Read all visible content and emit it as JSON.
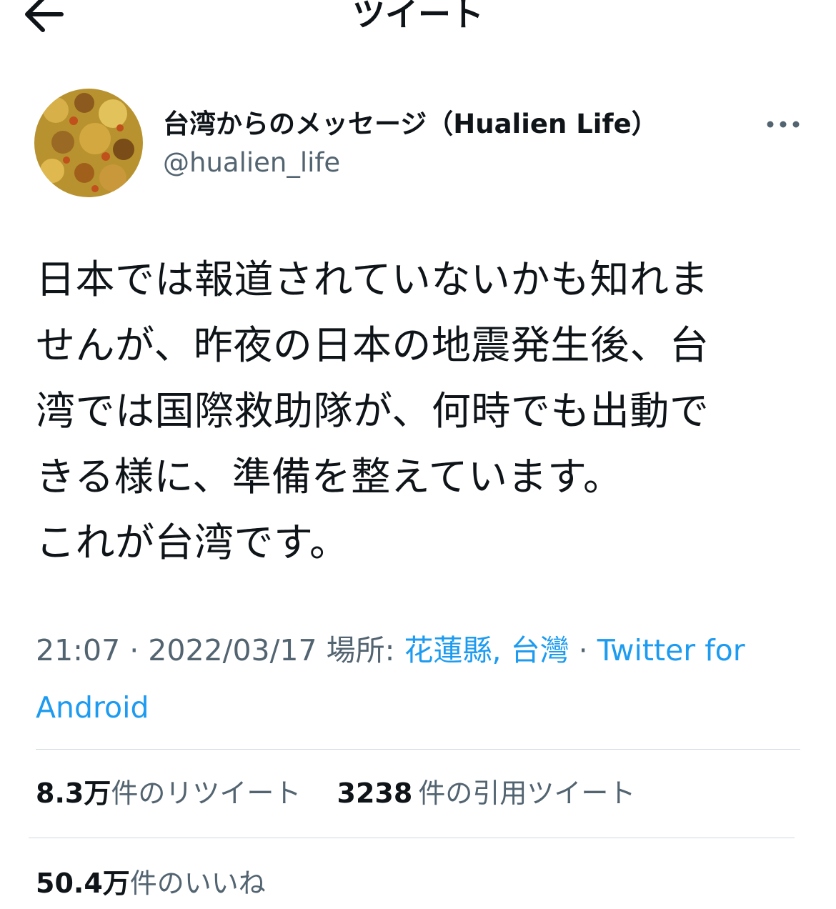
{
  "header": {
    "title": "ツイート",
    "back_icon": "arrow-left-icon",
    "more_icon": "more-horizontal-icon"
  },
  "author": {
    "display_name": "台湾からのメッセージ（Hualien Life）",
    "handle": "@hualien_life",
    "avatar_icon": "avatar-image"
  },
  "tweet": {
    "lines": [
      "日本では報道されていないかも知れま",
      "せんが、昨夜の日本の地震発生後、台",
      "湾では国際救助隊が、何時でも出動で",
      "きる様に、準備を整えています。",
      "これが台湾です。"
    ]
  },
  "meta": {
    "time": "21:07",
    "sep": "·",
    "date": "2022/03/17",
    "place_label": "場所:",
    "place": "花蓮縣, 台灣",
    "source_line1": "Twitter for",
    "source_line2": "Android"
  },
  "stats": {
    "retweets_count": "8.3",
    "retweets_unit": "万",
    "retweets_label": "件のリツイート",
    "quotes_count": "3238",
    "quotes_label": "件の引用ツイート",
    "likes_count": "50.4",
    "likes_unit": "万",
    "likes_label": "件のいいね"
  },
  "colors": {
    "text": "#0f1419",
    "secondary": "#536471",
    "link": "#1d9bf0",
    "divider": "#cfd9de"
  }
}
